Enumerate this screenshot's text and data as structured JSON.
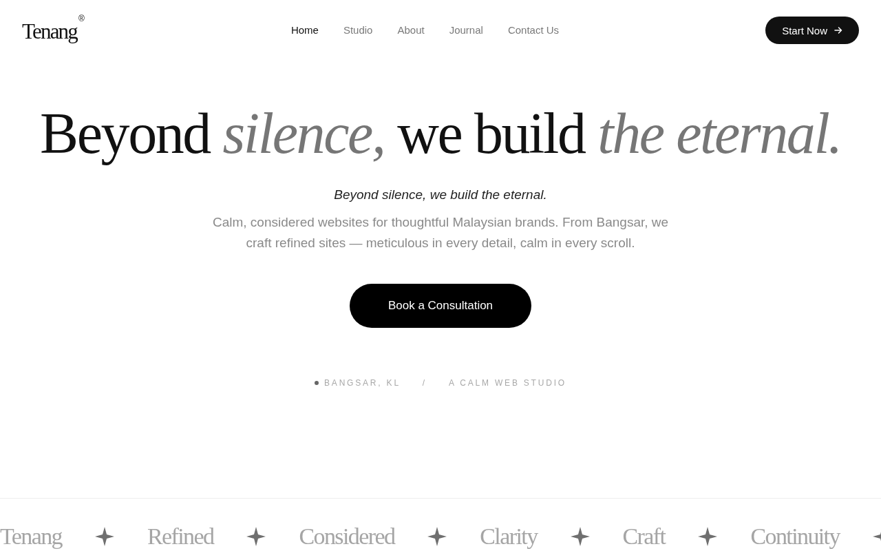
{
  "header": {
    "logo": {
      "text": "Tenang",
      "mark": "®"
    },
    "nav": [
      {
        "label": "Home",
        "selected": true
      },
      {
        "label": "Studio",
        "selected": false
      },
      {
        "label": "About",
        "selected": false
      },
      {
        "label": "Journal",
        "selected": false
      },
      {
        "label": "Contact Us",
        "selected": false
      }
    ],
    "cta": {
      "label": "Start Now"
    }
  },
  "hero": {
    "headline": "Beyond *silence,* we build *the eternal.*",
    "tagline": "Beyond silence, we build the eternal.",
    "description": "Calm, considered websites for thoughtful Malaysian brands. From Bangsar, we craft refined sites — meticulous in every detail, calm in every scroll.",
    "button": {
      "label": "Book a Consultation"
    },
    "meta": {
      "location": "BANGSAR, KL",
      "separator": "/",
      "descriptor": "A CALM WEB STUDIO"
    }
  },
  "marquee": {
    "items": [
      "Tenang",
      "Refined",
      "Considered",
      "Clarity",
      "Craft",
      "Continuity"
    ]
  }
}
